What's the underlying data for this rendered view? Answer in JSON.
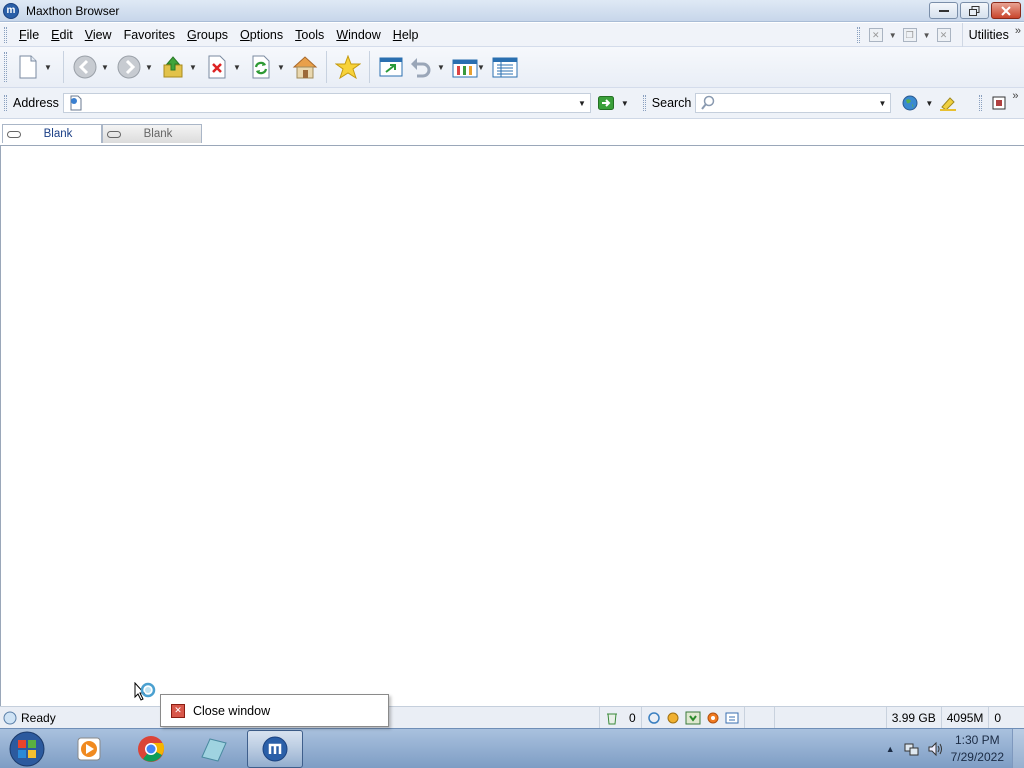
{
  "window": {
    "title": "Maxthon Browser",
    "logo_letter": "m"
  },
  "menu": {
    "items": [
      {
        "label": "File",
        "key": "F",
        "rest": "ile"
      },
      {
        "label": "Edit",
        "key": "E",
        "rest": "dit"
      },
      {
        "label": "View",
        "key": "V",
        "rest": "iew"
      },
      {
        "label": "Favorites",
        "key": "F",
        "rest": "avorites"
      },
      {
        "label": "Groups",
        "key": "G",
        "rest": "roups"
      },
      {
        "label": "Options",
        "key": "O",
        "rest": "ptions"
      },
      {
        "label": "Tools",
        "key": "T",
        "rest": "ools"
      },
      {
        "label": "Window",
        "key": "W",
        "rest": "indow"
      },
      {
        "label": "Help",
        "key": "H",
        "rest": "elp"
      }
    ],
    "utilities_label": "Utilities",
    "chevron": "»"
  },
  "address": {
    "label": "Address",
    "value": ""
  },
  "search": {
    "label": "Search",
    "value": ""
  },
  "tabs": [
    {
      "label": "Blank",
      "active": true
    },
    {
      "label": "Blank",
      "active": false
    }
  ],
  "popup": {
    "label": "Close window"
  },
  "status": {
    "text": "Ready",
    "counter": "0",
    "disk": "3.99 GB",
    "memory": "4095M",
    "last": "0"
  },
  "taskbar": {
    "time": "1:30 PM",
    "date": "7/29/2022"
  },
  "colors": {
    "title_gradient_top": "#dfe9f5",
    "taskbar": "#8fabd0",
    "close_red": "#c9452c",
    "active_tab_text": "#1b3f86"
  }
}
